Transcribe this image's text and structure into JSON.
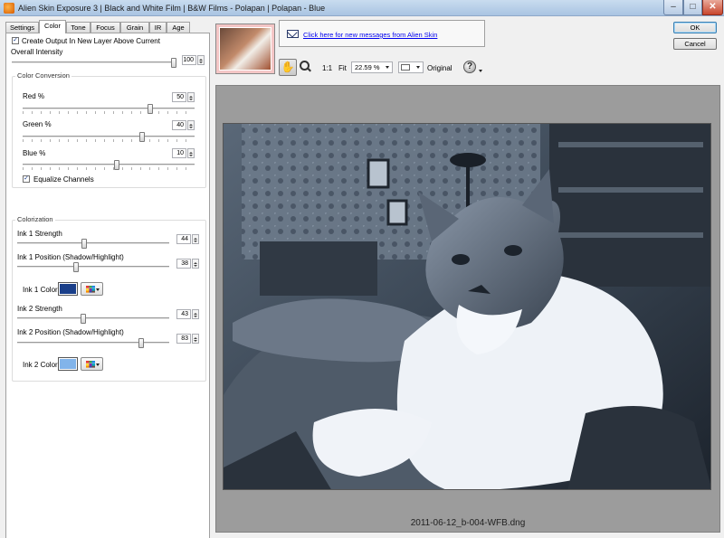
{
  "window": {
    "title": "Alien Skin Exposure 3 | Black and White Film | B&W Films - Polapan | Polapan - Blue",
    "min_glyph": "‒",
    "max_glyph": "□",
    "close_glyph": "✕"
  },
  "tabs": [
    {
      "label": "Settings"
    },
    {
      "label": "Color"
    },
    {
      "label": "Tone"
    },
    {
      "label": "Focus"
    },
    {
      "label": "Grain"
    },
    {
      "label": "IR"
    },
    {
      "label": "Age"
    }
  ],
  "active_tab": "Color",
  "options": {
    "create_output_label": "Create Output In New Layer Above Current",
    "create_output_checked": true,
    "overall_intensity_label": "Overall Intensity",
    "overall_intensity_value": "100",
    "overall_intensity_level": 1.0
  },
  "color_conversion": {
    "title": "Color Conversion",
    "red": {
      "label": "Red %",
      "value": "50",
      "level": 0.75
    },
    "green": {
      "label": "Green %",
      "value": "40",
      "level": 0.7
    },
    "blue": {
      "label": "Blue %",
      "value": "10",
      "level": 0.55
    },
    "equalize_label": "Equalize Channels",
    "equalize_checked": true
  },
  "colorization": {
    "title": "Colorization",
    "ink1_strength": {
      "label": "Ink 1 Strength",
      "value": "44",
      "level": 0.44
    },
    "ink1_position": {
      "label": "Ink 1 Position (Shadow/Highlight)",
      "value": "38",
      "level": 0.38
    },
    "ink1_color_label": "Ink 1 Color:",
    "ink1_color": "#1a3f8a",
    "ink2_strength": {
      "label": "Ink 2 Strength",
      "value": "43",
      "level": 0.43
    },
    "ink2_position": {
      "label": "Ink 2 Position (Shadow/Highlight)",
      "value": "83",
      "level": 0.83
    },
    "ink2_color_label": "Ink 2 Color:",
    "ink2_color": "#82b4ea"
  },
  "messages": {
    "link_text": "Click here for new messages from Alien Skin"
  },
  "buttons": {
    "ok": "OK",
    "cancel": "Cancel"
  },
  "toolbar": {
    "hand_glyph": "✋",
    "one_to_one": "1:1",
    "fit": "Fit",
    "zoom_value": "22.59 %",
    "original": "Original",
    "help_glyph": "?"
  },
  "preview": {
    "filename": "2011-06-12_b-004-WFB.dng"
  }
}
